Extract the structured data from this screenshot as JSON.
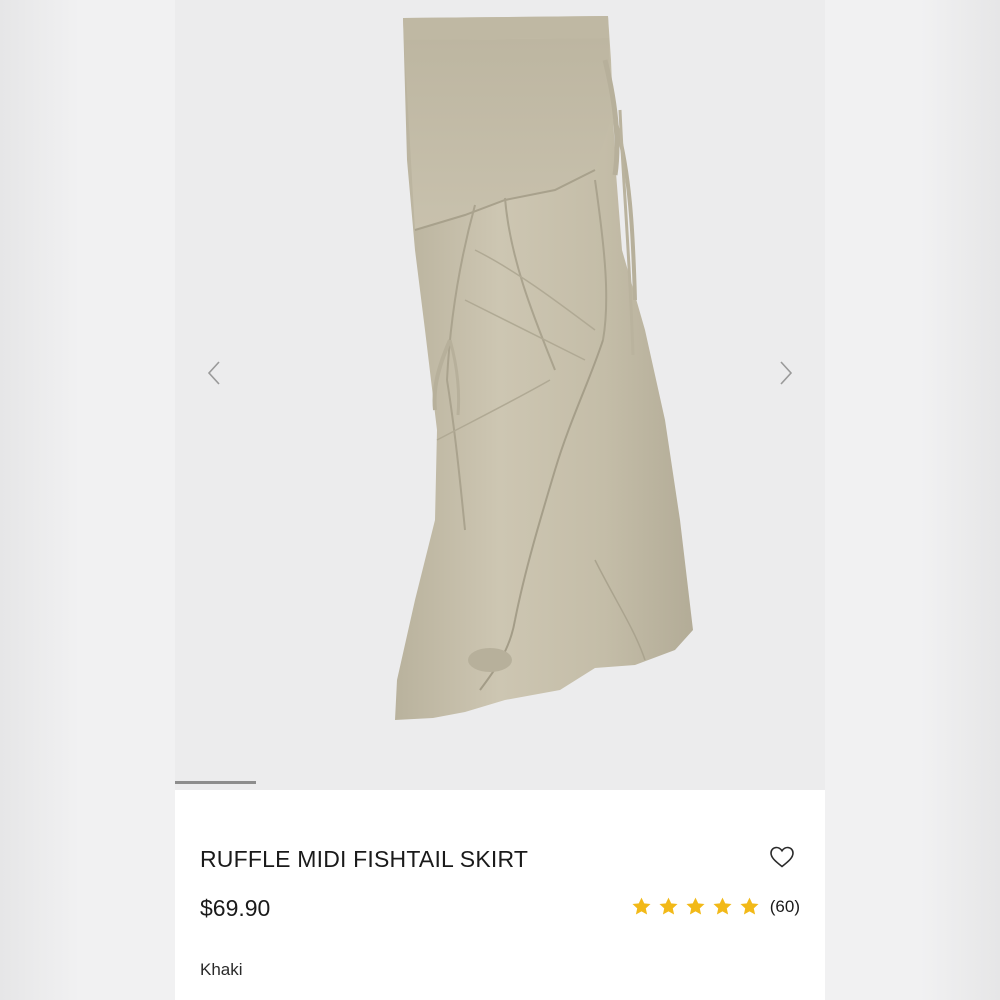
{
  "product": {
    "title": "RUFFLE MIDI FISHTAIL SKIRT",
    "price": "$69.90",
    "color": "Khaki",
    "rating": 5,
    "rating_max": 5,
    "review_count": "(60)"
  },
  "gallery": {
    "progress_fraction": 0.125,
    "icons": {
      "prev": "chevron-left-icon",
      "next": "chevron-right-icon",
      "wishlist": "heart-outline-icon",
      "star": "star-icon"
    }
  },
  "colors": {
    "star": "#f2b918",
    "skirt": "#c8c1ad",
    "background": "#ececed",
    "text": "#1a1a1a"
  }
}
